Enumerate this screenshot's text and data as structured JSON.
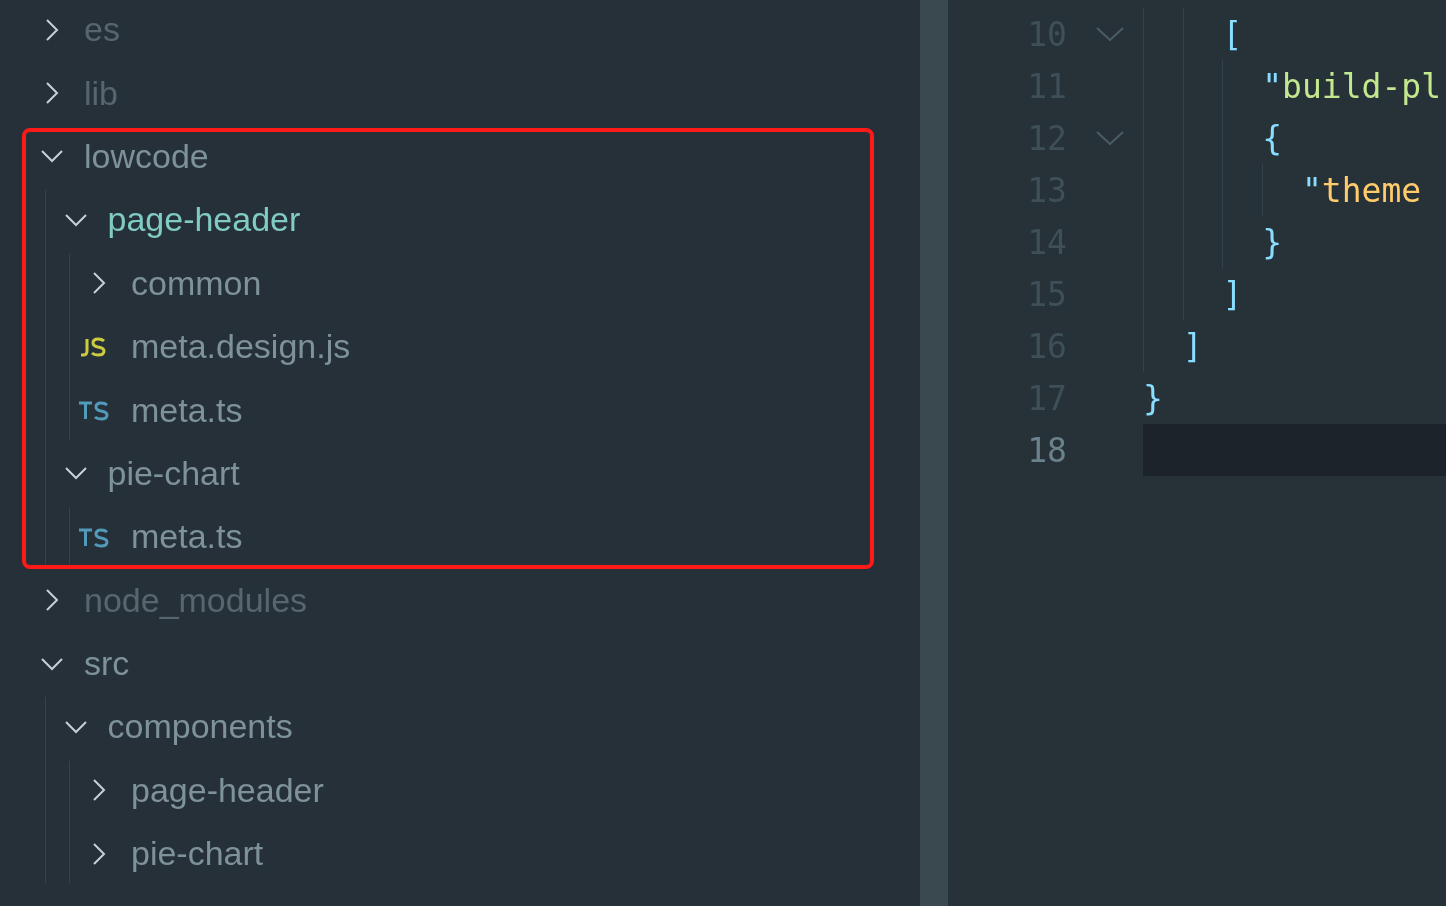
{
  "explorer": {
    "tree": [
      {
        "name": "es",
        "kind": "folder",
        "expanded": false,
        "ignored": true,
        "modified": false
      },
      {
        "name": "lib",
        "kind": "folder",
        "expanded": false,
        "ignored": true,
        "modified": false
      },
      {
        "name": "lowcode",
        "kind": "folder",
        "expanded": true,
        "ignored": false,
        "modified": false,
        "annotated": true,
        "children": [
          {
            "name": "page-header",
            "kind": "folder",
            "expanded": true,
            "ignored": false,
            "modified": true,
            "children": [
              {
                "name": "common",
                "kind": "folder",
                "expanded": false,
                "ignored": false,
                "modified": false
              },
              {
                "name": "meta.design.js",
                "kind": "js",
                "ignored": false,
                "modified": false
              },
              {
                "name": "meta.ts",
                "kind": "ts",
                "ignored": false,
                "modified": false
              }
            ]
          },
          {
            "name": "pie-chart",
            "kind": "folder",
            "expanded": true,
            "ignored": false,
            "modified": false,
            "children": [
              {
                "name": "meta.ts",
                "kind": "ts",
                "ignored": false,
                "modified": false
              }
            ]
          }
        ]
      },
      {
        "name": "node_modules",
        "kind": "folder",
        "expanded": false,
        "ignored": true,
        "modified": false
      },
      {
        "name": "src",
        "kind": "folder",
        "expanded": true,
        "ignored": false,
        "modified": false,
        "children": [
          {
            "name": "components",
            "kind": "folder",
            "expanded": true,
            "ignored": false,
            "modified": false,
            "children": [
              {
                "name": "page-header",
                "kind": "folder",
                "expanded": false,
                "ignored": false,
                "modified": false
              },
              {
                "name": "pie-chart",
                "kind": "folder",
                "expanded": false,
                "ignored": false,
                "modified": false
              }
            ]
          }
        ]
      }
    ]
  },
  "editor": {
    "lines": [
      {
        "number": "10",
        "foldable": true,
        "current": false,
        "tokens": [
          {
            "text": "    [",
            "kind": "punct"
          }
        ]
      },
      {
        "number": "11",
        "foldable": false,
        "current": false,
        "tokens": [
          {
            "text": "      \"",
            "kind": "punct"
          },
          {
            "text": "build-pl",
            "kind": "string"
          }
        ]
      },
      {
        "number": "12",
        "foldable": true,
        "current": false,
        "tokens": [
          {
            "text": "      {",
            "kind": "punct"
          }
        ]
      },
      {
        "number": "13",
        "foldable": false,
        "current": false,
        "tokens": [
          {
            "text": "        \"",
            "kind": "punct"
          },
          {
            "text": "theme",
            "kind": "key"
          }
        ]
      },
      {
        "number": "14",
        "foldable": false,
        "current": false,
        "tokens": [
          {
            "text": "      }",
            "kind": "punct"
          }
        ]
      },
      {
        "number": "15",
        "foldable": false,
        "current": false,
        "tokens": [
          {
            "text": "    ]",
            "kind": "punct"
          }
        ]
      },
      {
        "number": "16",
        "foldable": false,
        "current": false,
        "tokens": [
          {
            "text": "  ]",
            "kind": "punct"
          }
        ]
      },
      {
        "number": "17",
        "foldable": false,
        "current": false,
        "tokens": [
          {
            "text": "}",
            "kind": "punct"
          }
        ]
      },
      {
        "number": "18",
        "foldable": false,
        "current": true
      }
    ]
  }
}
